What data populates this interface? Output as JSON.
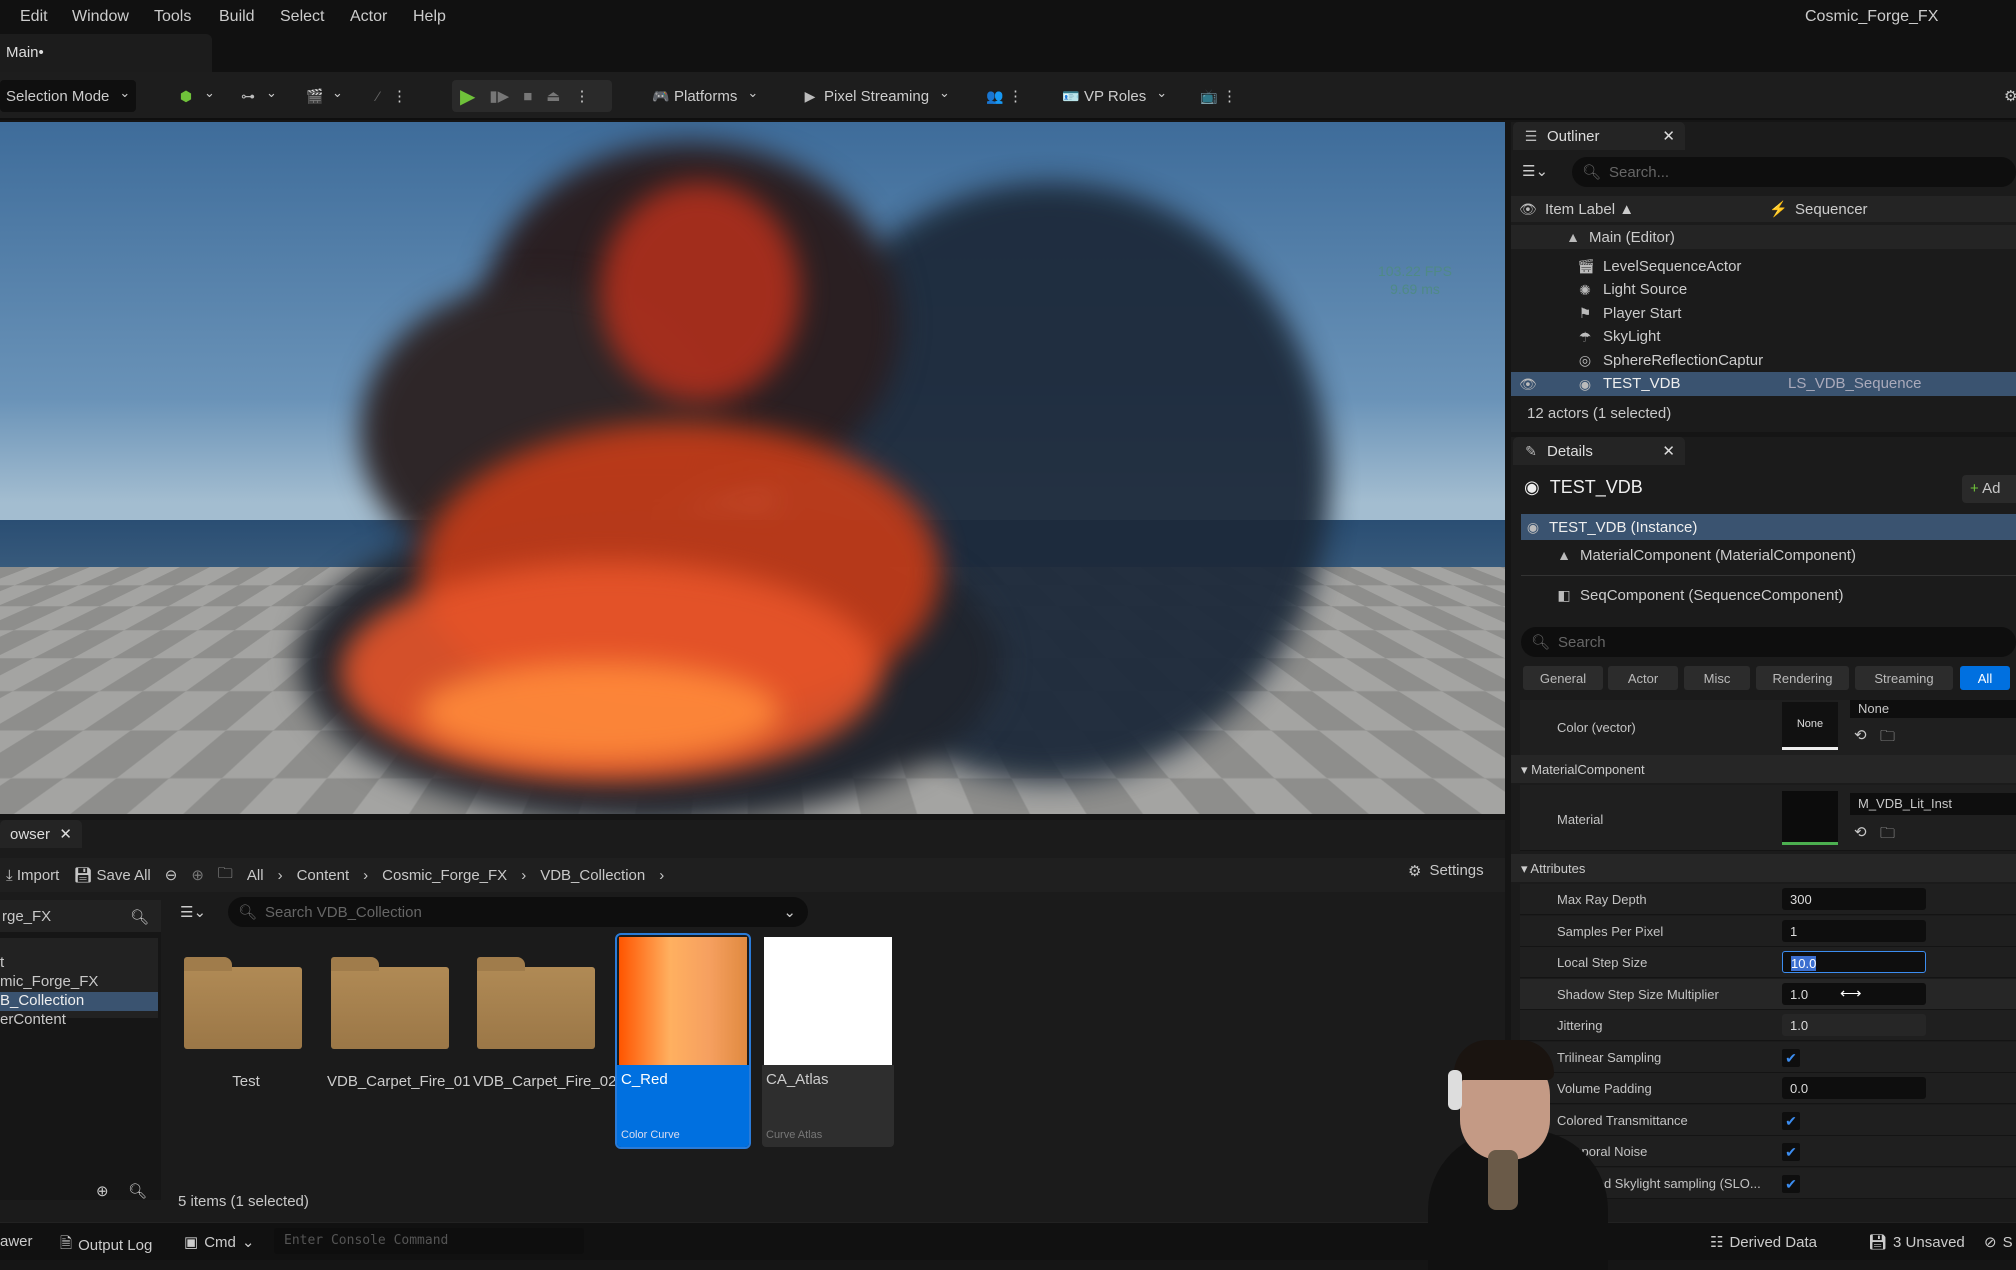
{
  "menu": [
    "Edit",
    "Window",
    "Tools",
    "Build",
    "Select",
    "Actor",
    "Help"
  ],
  "project_name": "Cosmic_Forge_FX",
  "level_tab": "Main•",
  "toolbar": {
    "selection_mode": "Selection Mode",
    "platforms": "Platforms",
    "pixel_streaming": "Pixel Streaming",
    "vp_roles": "VP Roles"
  },
  "viewport": {
    "fps": "103.22 FPS",
    "ms": "9.69 ms"
  },
  "outliner": {
    "tab": "Outliner",
    "search_placeholder": "Search...",
    "col_label": "Item Label ▲",
    "col_sequencer": "Sequencer",
    "root": "Main (Editor)",
    "items": [
      {
        "label": "LevelSequenceActor",
        "icon": "clapper-icon"
      },
      {
        "label": "Light Source",
        "icon": "sun-icon"
      },
      {
        "label": "Player Start",
        "icon": "flag-icon"
      },
      {
        "label": "SkyLight",
        "icon": "skylight-icon"
      },
      {
        "label": "SphereReflectionCaptur",
        "icon": "reflection-icon"
      },
      {
        "label": "TEST_VDB",
        "icon": "actor-icon",
        "sequencer": "LS_VDB_Sequence",
        "selected": true
      }
    ],
    "status": "12 actors (1 selected)"
  },
  "details": {
    "tab": "Details",
    "title": "TEST_VDB",
    "add_label": "Ad",
    "instance": "TEST_VDB (Instance)",
    "components": [
      "MaterialComponent (MaterialComponent)",
      "SeqComponent (SequenceComponent)"
    ],
    "search_placeholder": "Search",
    "filters": [
      "General",
      "Actor",
      "Misc",
      "Rendering",
      "Streaming",
      "All"
    ],
    "active_filter": "All",
    "color_vector": {
      "label": "Color (vector)",
      "thumb": "None",
      "value": "None"
    },
    "material_section": "MaterialComponent",
    "material": {
      "label": "Material",
      "value": "M_VDB_Lit_Inst"
    },
    "attributes_section": "Attributes",
    "attributes": [
      {
        "label": "Max Ray Depth",
        "value": "300"
      },
      {
        "label": "Samples Per Pixel",
        "value": "1"
      },
      {
        "label": "Local Step Size",
        "value": "10.0",
        "focused": true
      },
      {
        "label": "Shadow Step Size Multiplier",
        "value": "1.0"
      },
      {
        "label": "Jittering",
        "value": "1.0"
      },
      {
        "label": "Trilinear Sampling",
        "checked": true
      },
      {
        "label": "Volume Padding",
        "value": "0.0"
      },
      {
        "label": "Colored Transmittance",
        "checked": true
      },
      {
        "label": "Temporal Noise",
        "checked": true
      },
      {
        "label": "Improved Skylight sampling (SLO...",
        "checked": true
      }
    ]
  },
  "content_browser": {
    "tab": "owser",
    "import": "Import",
    "save_all": "Save All",
    "breadcrumb": [
      "All",
      "Content",
      "Cosmic_Forge_FX",
      "VDB_Collection"
    ],
    "settings": "Settings",
    "source_title": "rge_FX",
    "tree": [
      "t",
      "mic_Forge_FX",
      "B_Collection",
      "erContent"
    ],
    "selected_tree": "B_Collection",
    "search_placeholder": "Search VDB_Collection",
    "assets": [
      {
        "name": "Test",
        "type": "folder"
      },
      {
        "name": "VDB_Carpet_Fire_01",
        "type": "folder"
      },
      {
        "name": "VDB_Carpet_Fire_02",
        "type": "folder"
      },
      {
        "name": "C_Red",
        "type": "Color Curve",
        "selected": true
      },
      {
        "name": "CA_Atlas",
        "type": "Curve Atlas"
      }
    ],
    "status": "5 items (1 selected)"
  },
  "statusbar": {
    "drawer": "awer",
    "output_log": "Output Log",
    "cmd": "Cmd",
    "console_placeholder": "Enter Console Command",
    "derived_data": "Derived Data",
    "unsaved": "3 Unsaved",
    "source": "S"
  },
  "colors": {
    "accent": "#0070e0",
    "selection": "#3a5370",
    "play": "#6fc13a"
  }
}
